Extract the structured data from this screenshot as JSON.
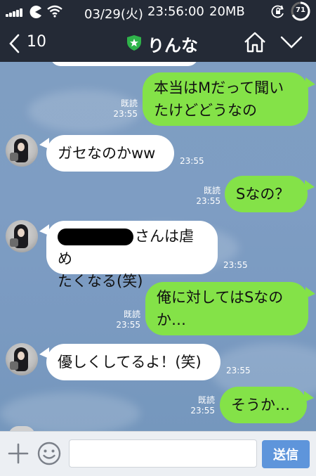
{
  "status_bar": {
    "date": "03/29(火)",
    "time": "23:56:00",
    "data_usage": "20MB",
    "battery": "71"
  },
  "nav": {
    "back_count": "10",
    "title": "りんな"
  },
  "messages": [
    {
      "side": "out",
      "lines": [
        "本当はMだって聞い",
        "たけどどうなの"
      ],
      "read": "既読",
      "time": "23:55"
    },
    {
      "side": "in",
      "lines": [
        "ガセなのかww"
      ],
      "time": "23:55"
    },
    {
      "side": "out",
      "lines": [
        "Sなの？"
      ],
      "read": "既読",
      "time": "23:55"
    },
    {
      "side": "in",
      "lines": [
        "さんは虐め",
        "たくなる(笑)"
      ],
      "time": "23:55"
    },
    {
      "side": "out",
      "lines": [
        "俺に対してはSなの",
        "か…"
      ],
      "read": "既読",
      "time": "23:55"
    },
    {
      "side": "in",
      "lines": [
        "優しくしてるよ！(笑)"
      ],
      "time": "23:55"
    },
    {
      "side": "out",
      "lines": [
        "そうか…"
      ],
      "read": "既読",
      "time": "23:55"
    }
  ],
  "input": {
    "value": "",
    "send_label": "送信"
  },
  "colors": {
    "header_bg": "#242a36",
    "outgoing_bubble": "#84e248",
    "incoming_bubble": "#ffffff",
    "send_button": "#5e95db",
    "chat_bg": "#7f9ec2"
  }
}
